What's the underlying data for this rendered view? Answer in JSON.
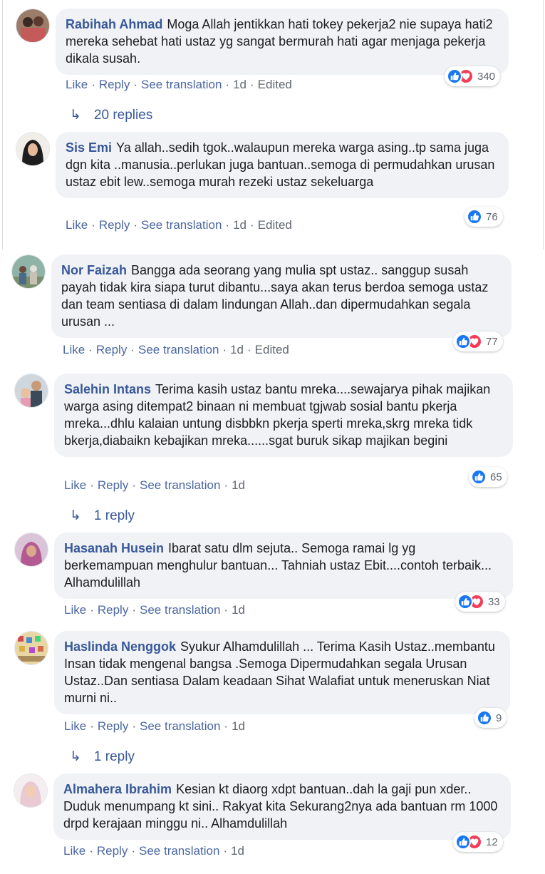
{
  "colors": {
    "author": "#385898",
    "link": "#4b67a1",
    "bubble": "#f0f2f5",
    "like": "#1877f2",
    "love": "#f33e58"
  },
  "icons": {
    "like": "thumbs-up-icon",
    "love": "heart-icon",
    "reply_arrow": "reply-arrow-icon"
  },
  "actions": {
    "like": "Like",
    "reply": "Reply",
    "translate": "See translation",
    "sep": "·"
  },
  "comments": [
    {
      "author": "Rabihah Ahmad",
      "text": "Moga Allah jentikkan hati tokey pekerja2 nie supaya hati2 mereka sehebat hati ustaz yg sangat bermurah hati agar menjaga pekerja dikala susah.",
      "time": "1d",
      "edited": "Edited",
      "reaction_count": "340",
      "reactions": [
        "like",
        "love"
      ],
      "replies": "20 replies"
    },
    {
      "author": "Sis Emi",
      "text": "Ya allah..sedih tgok..walaupun mereka warga asing..tp sama juga dgn kita ..manusia..perlukan juga bantuan..semoga di permudahkan urusan ustaz ebit lew..semoga murah rezeki ustaz sekeluarga",
      "time": "1d",
      "edited": "Edited",
      "reaction_count": "76",
      "reactions": [
        "like"
      ]
    },
    {
      "author": "Nor Faizah",
      "text": "Bangga ada seorang yang mulia spt ustaz.. sanggup susah payah tidak kira siapa turut dibantu...saya akan terus berdoa semoga ustaz dan team sentiasa di dalam lindungan Allah..dan dipermudahkan segala urusan ...",
      "time": "1d",
      "edited": "Edited",
      "reaction_count": "77",
      "reactions": [
        "like",
        "love"
      ]
    },
    {
      "author": "Salehin Intans",
      "text": "Terima kasih ustaz bantu mreka....sewajarya pihak majikan warga asing ditempat2 binaan ni membuat tgjwab sosial bantu pkerja mreka...dhlu kalaian untung disbbkn pkerja sperti mreka,skrg mreka tidk bkerja,diabaikn kebajikan mreka......sgat buruk sikap majikan begini",
      "time": "1d",
      "reaction_count": "65",
      "reactions": [
        "like"
      ],
      "replies": "1 reply"
    },
    {
      "author": "Hasanah Husein",
      "text": "Ibarat satu dlm sejuta.. Semoga ramai lg yg berkemampuan menghulur bantuan... Tahniah ustaz Ebit....contoh terbaik... Alhamdulillah",
      "time": "1d",
      "reaction_count": "33",
      "reactions": [
        "like",
        "love"
      ]
    },
    {
      "author": "Haslinda Nenggok",
      "text": "Syukur Alhamdulillah ... Terima Kasih Ustaz..membantu Insan tidak mengenal bangsa .Semoga Dipermudahkan segala Urusan Ustaz..Dan sentiasa Dalam keadaan Sihat Walafiat untuk meneruskan Niat murni ni..",
      "time": "1d",
      "reaction_count": "9",
      "reactions": [
        "like"
      ],
      "replies": "1 reply"
    },
    {
      "author": "Almahera Ibrahim",
      "text": "Kesian kt diaorg xdpt bantuan..dah la gaji pun xder.. Duduk menumpang kt sini.. Rakyat kita Sekurang2nya ada bantuan rm 1000 drpd kerajaan minggu ni.. Alhamdulillah",
      "time": "1d",
      "reaction_count": "12",
      "reactions": [
        "like",
        "love"
      ]
    }
  ]
}
